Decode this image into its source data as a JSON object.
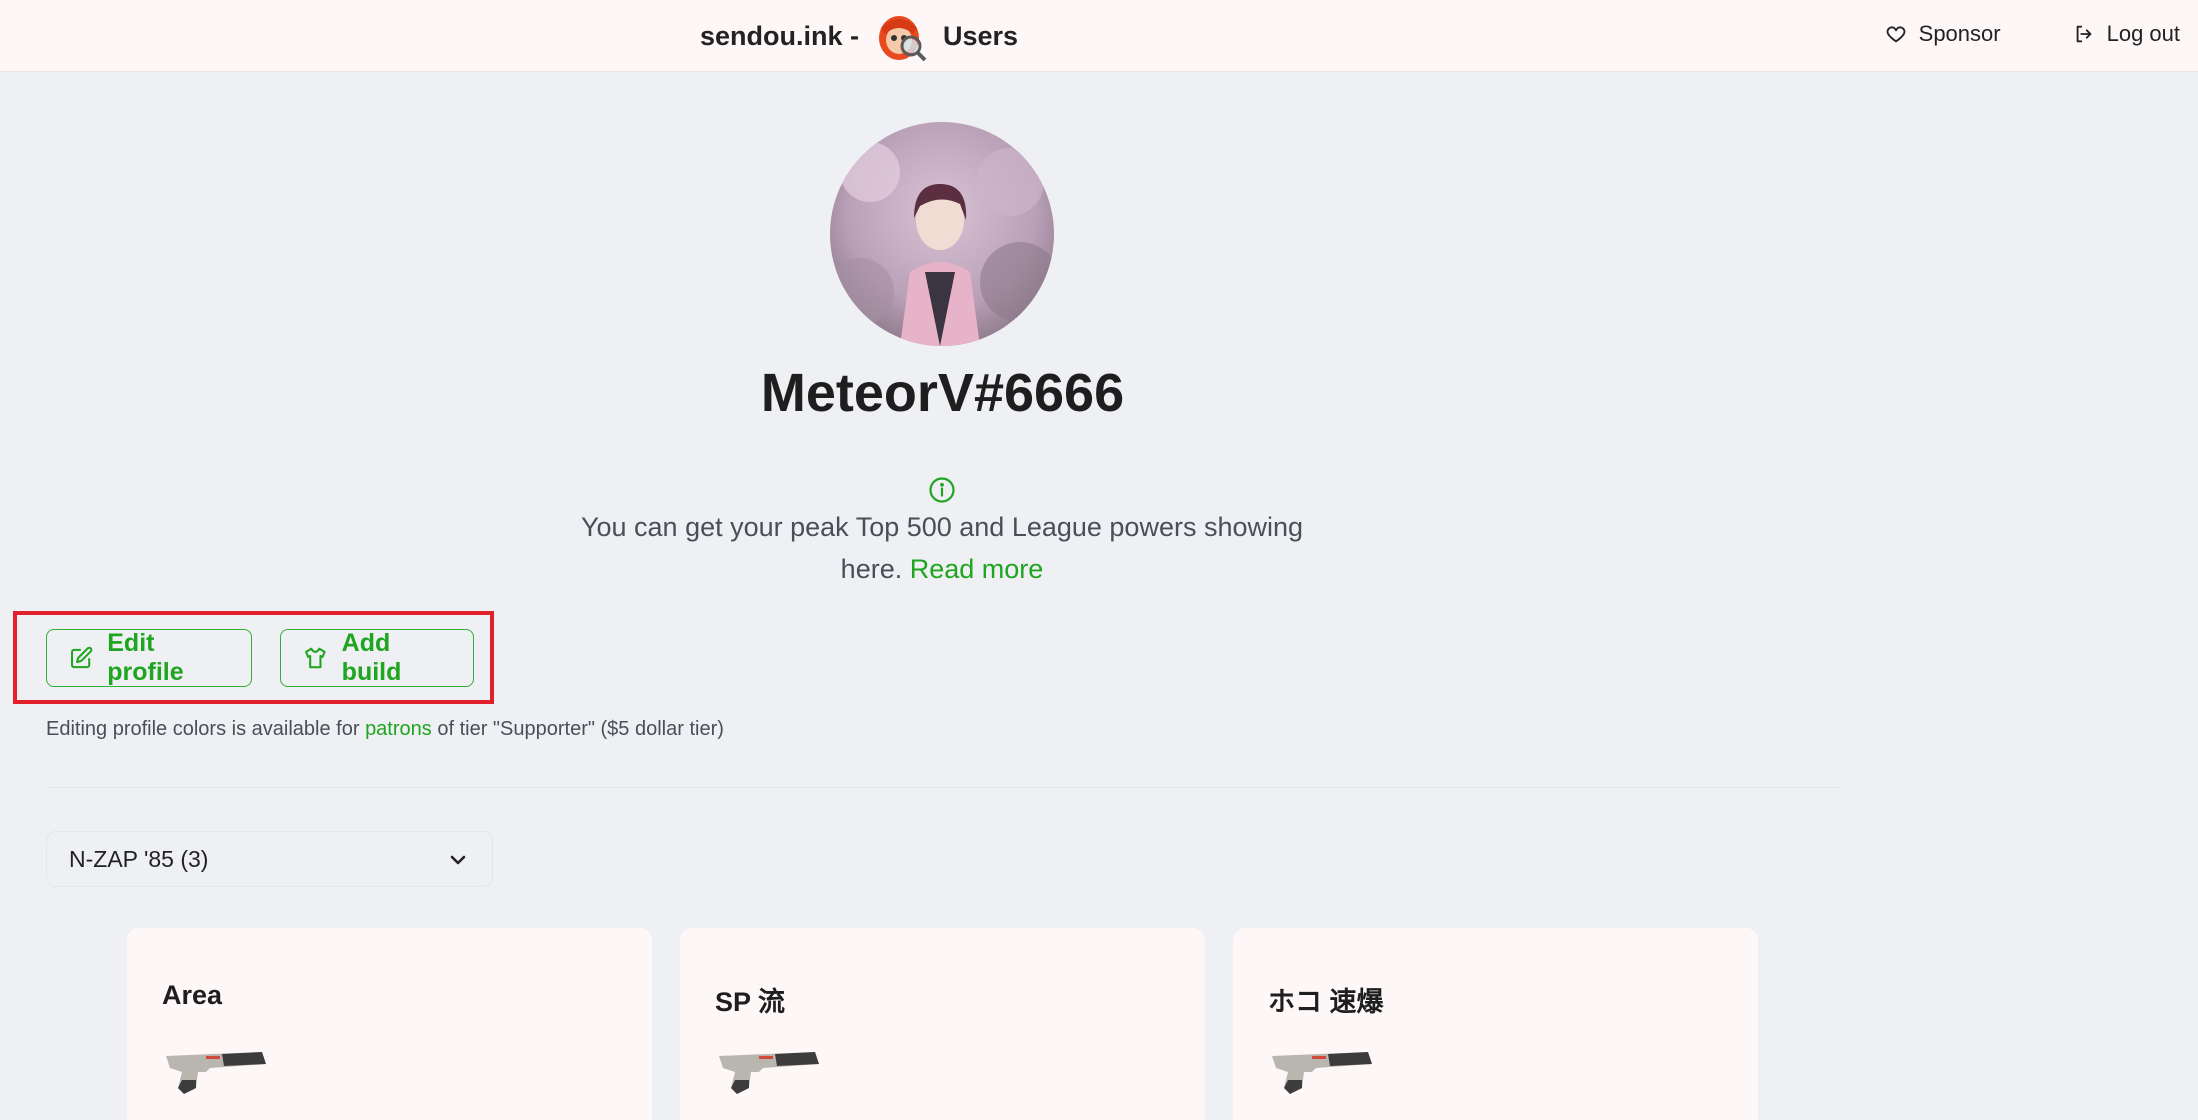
{
  "header": {
    "site_name": "sendou.ink -",
    "section": "Users",
    "sponsor_label": "Sponsor",
    "logout_label": "Log out"
  },
  "profile": {
    "username": "MeteorV#6666",
    "info_text": "You can get your peak Top 500 and League powers showing here.",
    "info_link": "Read more"
  },
  "actions": {
    "edit_profile": "Edit profile",
    "add_build": "Add build"
  },
  "note": {
    "before": "Editing profile colors is available for",
    "link": "patrons",
    "after": "of tier \"Supporter\" ($5 dollar tier)"
  },
  "weapon_select": {
    "selected": "N-ZAP '85 (3)"
  },
  "builds": [
    {
      "title": "Area",
      "weapon": "nzap-85-icon"
    },
    {
      "title": "SP 流",
      "weapon": "nzap-85-icon"
    },
    {
      "title": "ホコ 速爆",
      "weapon": "nzap-85-icon"
    }
  ],
  "colors": {
    "accent": "#1fa51f",
    "highlight": "#e0202a",
    "background": "#eef0f4",
    "card": "#fdf8f7"
  }
}
